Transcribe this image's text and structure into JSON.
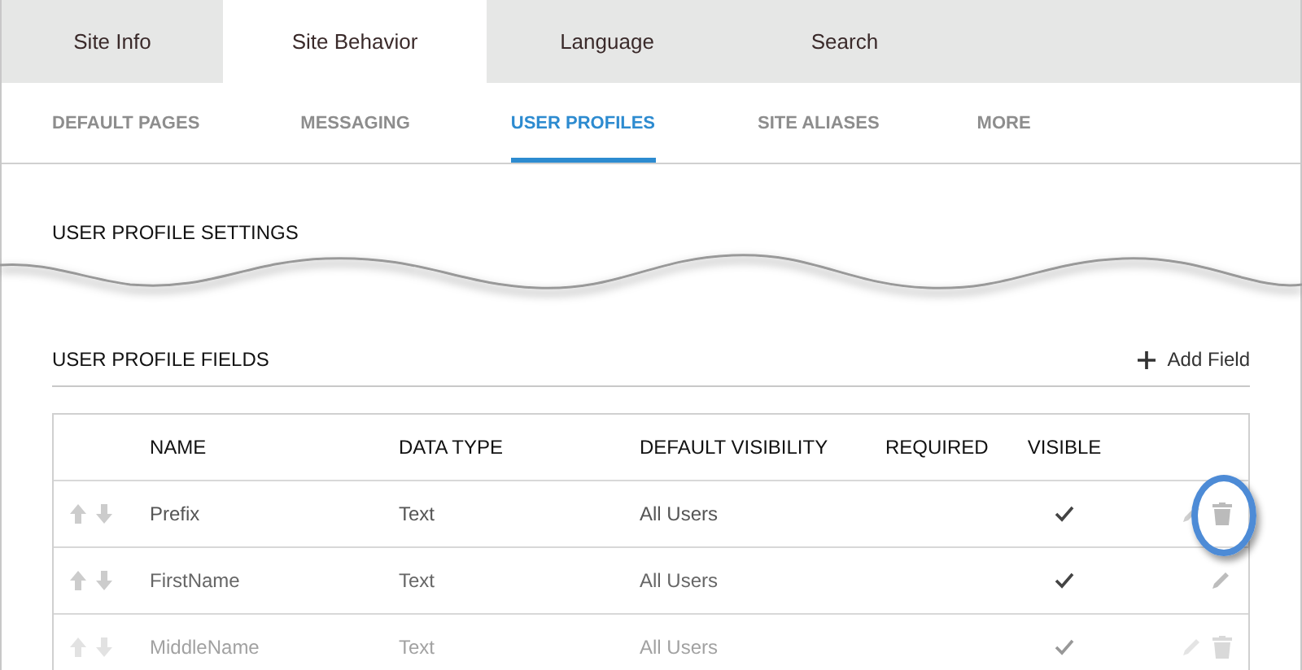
{
  "tabs": [
    {
      "label": "Site Info",
      "selected": false
    },
    {
      "label": "Site Behavior",
      "selected": true
    },
    {
      "label": "Language",
      "selected": false
    },
    {
      "label": "Search",
      "selected": false
    }
  ],
  "subtabs": [
    {
      "label": "DEFAULT PAGES",
      "selected": false
    },
    {
      "label": "MESSAGING",
      "selected": false
    },
    {
      "label": "USER PROFILES",
      "selected": true
    },
    {
      "label": "SITE ALIASES",
      "selected": false
    },
    {
      "label": "MORE",
      "selected": false
    }
  ],
  "settings_section": {
    "title": "USER PROFILE SETTINGS"
  },
  "fields_section": {
    "title": "USER PROFILE FIELDS",
    "add_button": "Add Field"
  },
  "table": {
    "columns": [
      "NAME",
      "DATA TYPE",
      "DEFAULT VISIBILITY",
      "REQUIRED",
      "VISIBLE"
    ],
    "rows": [
      {
        "name": "Prefix",
        "data_type": "Text",
        "default_visibility": "All Users",
        "required": false,
        "visible": true,
        "hovered": true,
        "highlighted": true,
        "faded": false
      },
      {
        "name": "FirstName",
        "data_type": "Text",
        "default_visibility": "All Users",
        "required": false,
        "visible": true,
        "hovered": false,
        "highlighted": false,
        "faded": false
      },
      {
        "name": "MiddleName",
        "data_type": "Text",
        "default_visibility": "All Users",
        "required": false,
        "visible": true,
        "hovered": true,
        "highlighted": false,
        "faded": true
      }
    ]
  }
}
